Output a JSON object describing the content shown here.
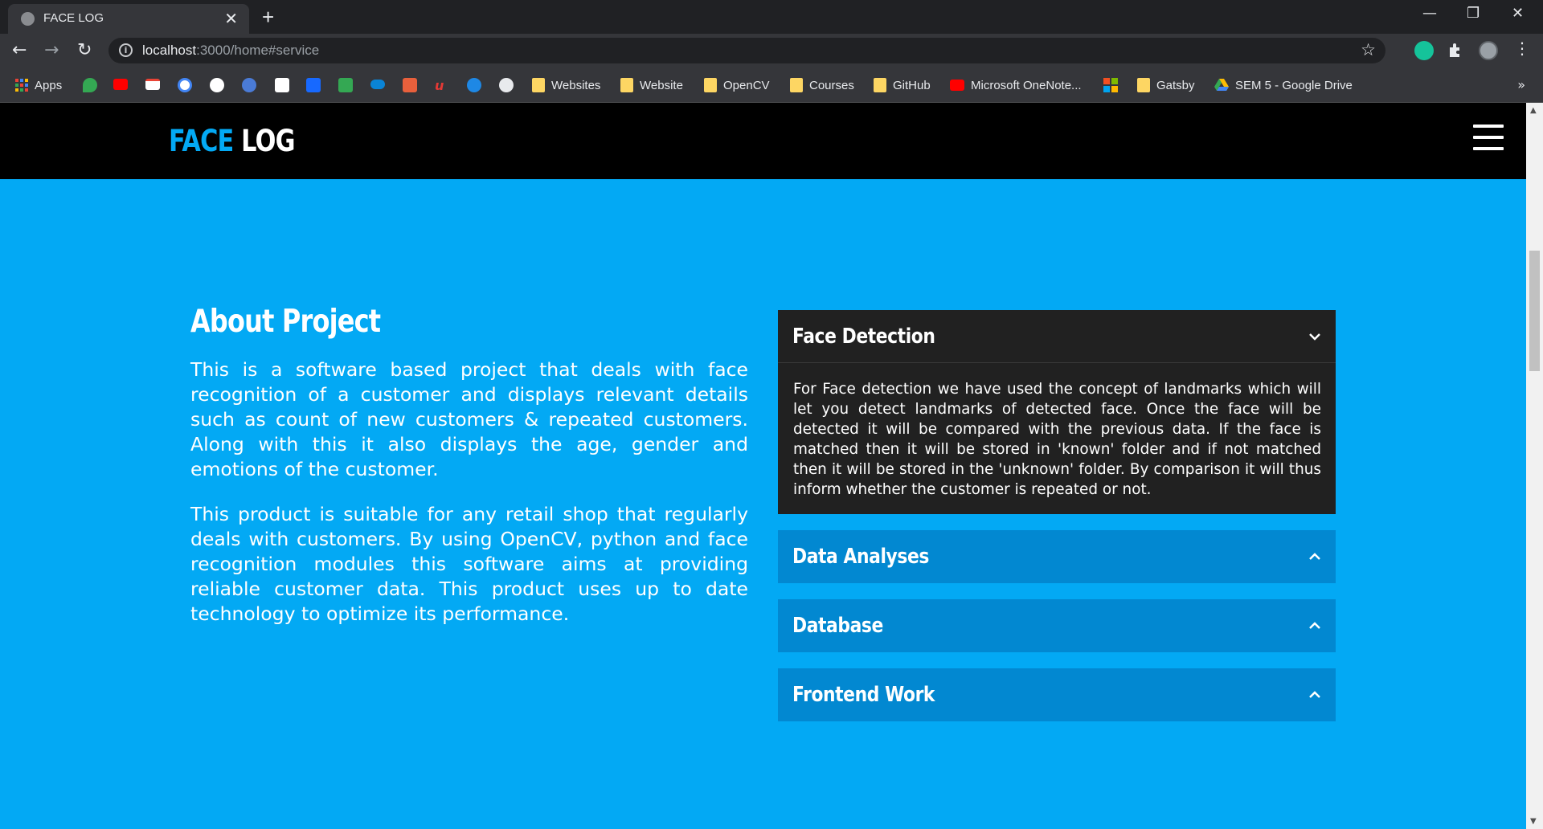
{
  "browser": {
    "tab_title": "FACE LOG",
    "tab_close": "✕",
    "new_tab": "+",
    "window_controls": [
      "—",
      "❐",
      "✕"
    ],
    "nav": {
      "back": "←",
      "forward": "→",
      "reload": "↻"
    },
    "url_host": "localhost",
    "url_path": ":3000/home#service",
    "star": "☆",
    "bookmarks": [
      {
        "label": "Apps",
        "icon": "apps-grid-icon"
      },
      {
        "label": "Websites",
        "icon": "folder-icon"
      },
      {
        "label": "Website",
        "icon": "folder-icon"
      },
      {
        "label": "OpenCV",
        "icon": "folder-icon"
      },
      {
        "label": "Courses",
        "icon": "folder-icon"
      },
      {
        "label": "GitHub",
        "icon": "folder-icon"
      },
      {
        "label": "Microsoft OneNote...",
        "icon": "youtube-icon"
      },
      {
        "label": "Gatsby",
        "icon": "folder-icon"
      },
      {
        "label": "SEM 5 - Google Drive",
        "icon": "google-drive-icon"
      }
    ],
    "bookmarks_overflow": "»"
  },
  "site": {
    "logo_part1": "FACE",
    "logo_part2": "LOG"
  },
  "about": {
    "heading": "About Project",
    "paragraphs": [
      "This is a software based project that deals with face recognition of a customer and displays relevant details such as count of new customers & repeated customers. Along with this it also displays the age, gender and emotions of the customer.",
      "This product is suitable for any retail shop that regularly deals with customers. By using OpenCV, python and face recognition modules this software aims at providing reliable customer data. This product uses up to date technology to optimize its performance."
    ]
  },
  "accordion": {
    "items": [
      {
        "title": "Face Detection",
        "expanded": true,
        "chevron": "⌄",
        "body": "For Face detection we have used the concept of landmarks which will let you detect landmarks of detected face. Once the face will be detected it will be compared with the previous data. If the face is matched then it will be stored in 'known' folder and if not matched then it will be stored in the 'unknown' folder. By comparison it will thus inform whether the customer is repeated or not."
      },
      {
        "title": "Data Analyses",
        "expanded": false,
        "chevron": "⌃"
      },
      {
        "title": "Database",
        "expanded": false,
        "chevron": "⌃"
      },
      {
        "title": "Frontend Work",
        "expanded": false,
        "chevron": "⌃"
      }
    ]
  },
  "colors": {
    "page_bg": "#03a9f4",
    "header_bg": "#000000",
    "accent": "#03a9f4",
    "accordion_open_bg": "#212121",
    "accordion_closed_bg": "#0288d1"
  }
}
